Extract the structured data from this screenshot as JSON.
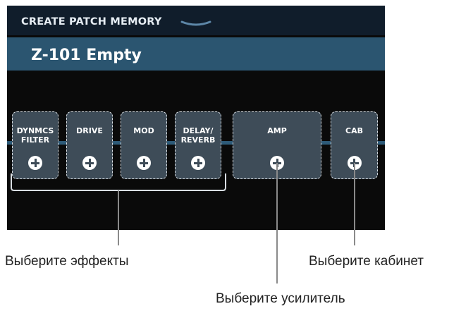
{
  "header": {
    "title": "CREATE PATCH MEMORY"
  },
  "patch": {
    "name": "Z-101 Empty"
  },
  "slots": [
    {
      "label": "DYNMCS\nFILTER",
      "icon": "plus-circle-icon"
    },
    {
      "label": "DRIVE",
      "icon": "plus-circle-icon"
    },
    {
      "label": "MOD",
      "icon": "plus-circle-icon"
    },
    {
      "label": "DELAY/\nREVERB",
      "icon": "plus-circle-icon"
    },
    {
      "label": "AMP",
      "icon": "plus-circle-icon"
    },
    {
      "label": "CAB",
      "icon": "plus-circle-icon"
    }
  ],
  "callouts": {
    "effects": "Выберите эффекты",
    "amp": "Выберите усилитель",
    "cab": "Выберите кабинет"
  },
  "colors": {
    "screen_bg": "#0a0a0a",
    "header_bg": "#101d2b",
    "patch_bar": "#2b5570",
    "slot_bg": "#3e4c58",
    "chain": "#2d5a78"
  }
}
